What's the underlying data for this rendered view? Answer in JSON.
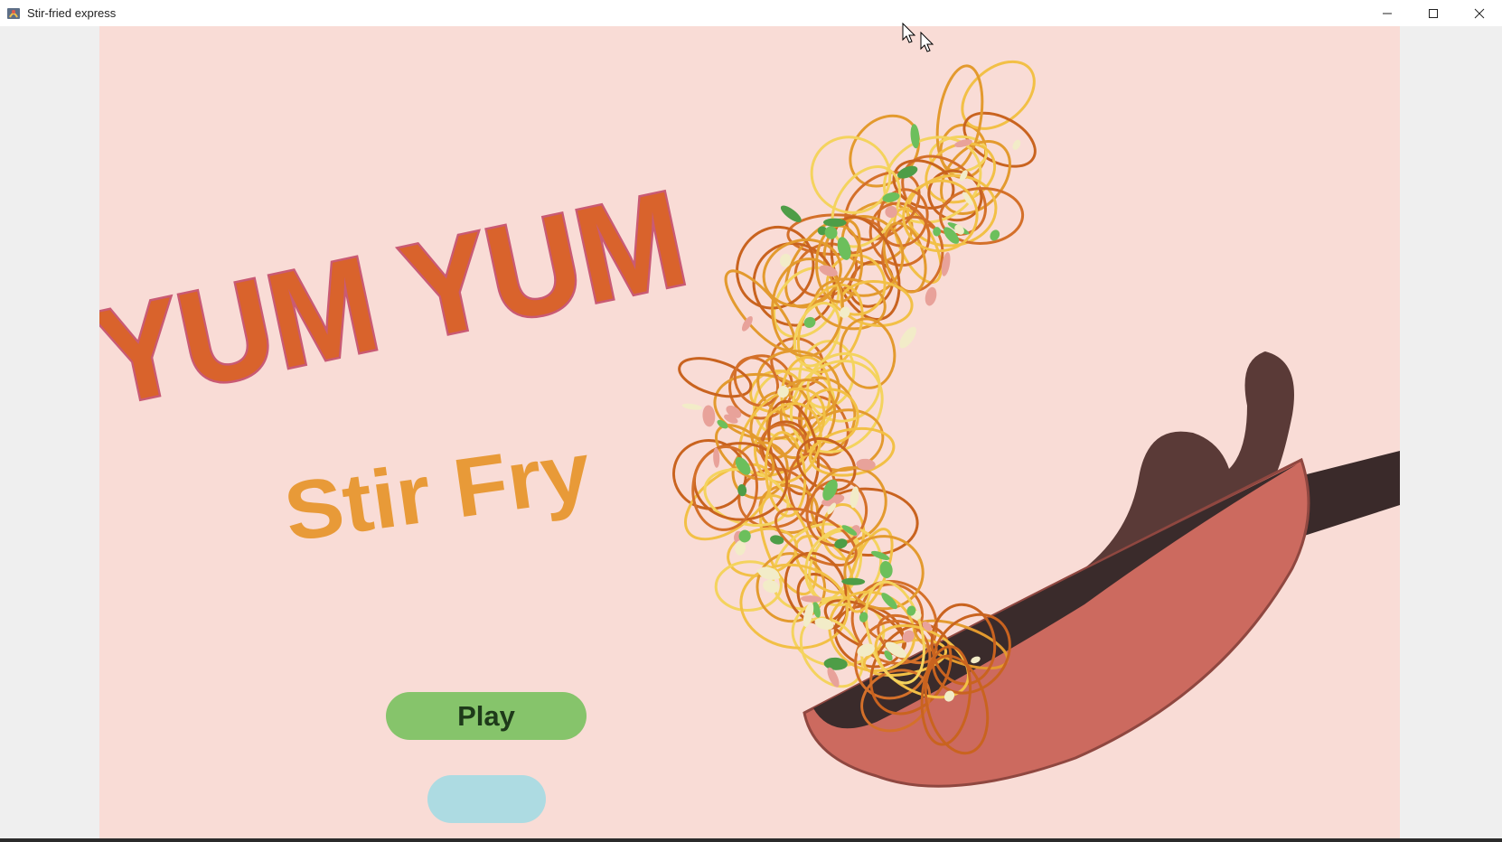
{
  "window": {
    "title": "Stir-fried express",
    "icon": "java-app-icon",
    "controls": {
      "minimize": "–",
      "maximize": "☐",
      "close": "✕"
    }
  },
  "game": {
    "title_line1": "YUM YUM",
    "title_line2": "Stir Fry",
    "play_label": "Play",
    "second_button_label": ""
  },
  "colors": {
    "background": "#f9dcd6",
    "title_primary": "#d9632c",
    "title_outline": "#c95a74",
    "subtitle": "#e89a38",
    "play_button": "#86c46b",
    "second_button": "#addbe2",
    "wok": "#cc6a5f",
    "smoke": "#5a3a37"
  }
}
